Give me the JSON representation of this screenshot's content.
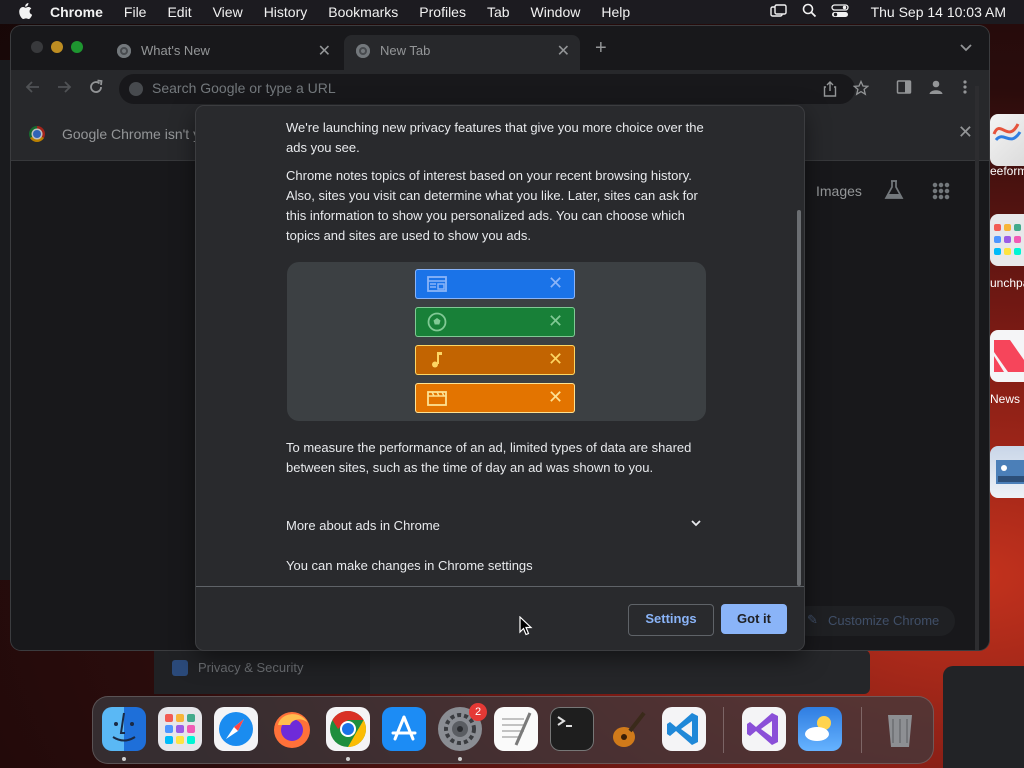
{
  "menubar": {
    "items": [
      "Chrome",
      "File",
      "Edit",
      "View",
      "History",
      "Bookmarks",
      "Profiles",
      "Tab",
      "Window",
      "Help"
    ],
    "clock": "Thu Sep 14  10:03 AM"
  },
  "background": {
    "settings_item": "Privacy & Security",
    "launchpad_labels": [
      "eeform",
      "unchpa",
      "News"
    ]
  },
  "browser": {
    "tabs": [
      {
        "title": "What's New",
        "active": false
      },
      {
        "title": "New Tab",
        "active": true
      }
    ],
    "new_tab_glyph": "+",
    "omnibox_placeholder": "Search Google or type a URL",
    "infobar_text": "Google Chrome isn't y",
    "ntp": {
      "images_link": "Images",
      "customize_label": "Customize Chrome"
    }
  },
  "dialog": {
    "intro": "We're launching new privacy features that give you more choice over the ads you see.",
    "body1": "Chrome notes topics of interest based on your recent browsing history. Also, sites you visit can determine what you like. Later, sites can ask for this information to show you personalized ads. You can choose which topics and sites are used to show you ads.",
    "illustration": [
      {
        "icon": "browser-window-icon",
        "color": "#1a73e8",
        "fg": "#8ab4f8"
      },
      {
        "icon": "soccer-ball-icon",
        "color": "#188038",
        "fg": "#81c995"
      },
      {
        "icon": "music-note-icon",
        "color": "#c26401",
        "fg": "#fdd663"
      },
      {
        "icon": "clapperboard-icon",
        "color": "#e37400",
        "fg": "#fde293"
      }
    ],
    "body2": "To measure the performance of an ad, limited types of data are shared between sites, such as the time of day an ad was shown to you.",
    "more_label": "More about ads in Chrome",
    "changes_label": "You can make changes in Chrome settings",
    "settings_button": "Settings",
    "gotit_button": "Got it"
  },
  "dock": {
    "apps": [
      "Finder",
      "Launchpad",
      "Safari",
      "Firefox",
      "Google Chrome",
      "App Store",
      "System Settings",
      "TextEdit",
      "Terminal",
      "GarageBand",
      "Visual Studio Code",
      "Visual Studio",
      "Weather",
      "Trash"
    ],
    "system_settings_badge": "2"
  },
  "colors": {
    "accent": "#8ab4f8",
    "dialog_bg": "#292a2d",
    "window_bg": "#202124"
  }
}
